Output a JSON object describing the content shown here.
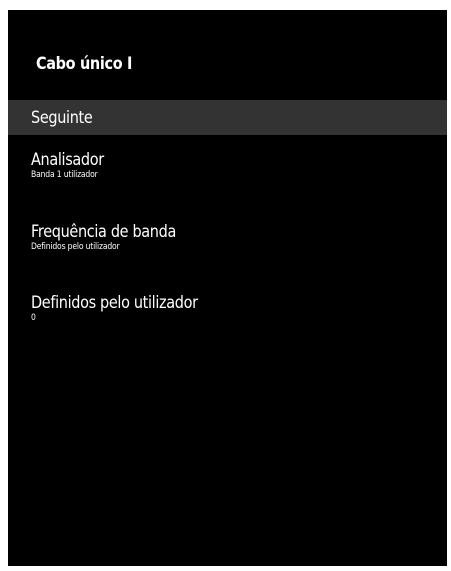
{
  "screen": {
    "title": "Cabo único I",
    "next_label": "Seguinte",
    "items": [
      {
        "label": "Analisador",
        "value": "Banda 1 utilizador"
      },
      {
        "label": "Frequência de banda",
        "value": "Definidos pelo utilizador"
      },
      {
        "label": "Definidos pelo utilizador",
        "value": "0"
      }
    ]
  },
  "colors": {
    "background": "#000000",
    "highlight": "#333333",
    "text": "#ffffff"
  }
}
